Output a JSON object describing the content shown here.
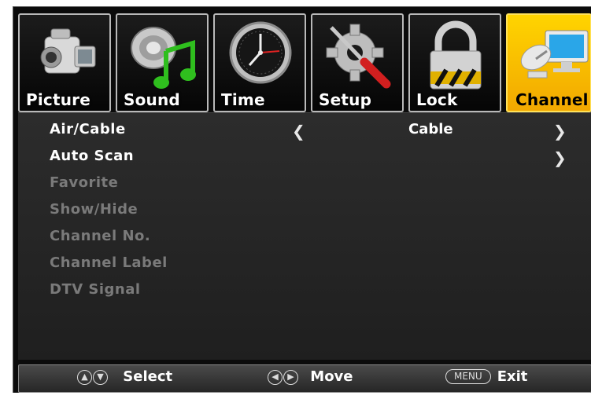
{
  "tabs": [
    {
      "label": "Picture",
      "icon": "camera-icon"
    },
    {
      "label": "Sound",
      "icon": "music-note-icon"
    },
    {
      "label": "Time",
      "icon": "clock-icon"
    },
    {
      "label": "Setup",
      "icon": "gear-screwdriver-icon"
    },
    {
      "label": "Lock",
      "icon": "padlock-icon"
    },
    {
      "label": "Channel",
      "icon": "satellite-monitor-icon",
      "active": true
    }
  ],
  "menu": {
    "rows": [
      {
        "label": "Air/Cable",
        "value": "Cable",
        "left_arrow": "❮",
        "right_arrow": "❯",
        "enabled": true
      },
      {
        "label": "Auto Scan",
        "right_arrow": "❯",
        "enabled": true
      },
      {
        "label": "Favorite",
        "enabled": false
      },
      {
        "label": "Show/Hide",
        "enabled": false
      },
      {
        "label": "Channel No.",
        "enabled": false
      },
      {
        "label": "Channel Label",
        "enabled": false
      },
      {
        "label": "DTV Signal",
        "enabled": false
      }
    ]
  },
  "footer": {
    "select_label": "Select",
    "move_label": "Move",
    "menu_key": "MENU",
    "exit_label": "Exit"
  },
  "colors": {
    "active_tab": "#f5b800",
    "panel": "#262626",
    "disabled_text": "#7a7a7a"
  }
}
